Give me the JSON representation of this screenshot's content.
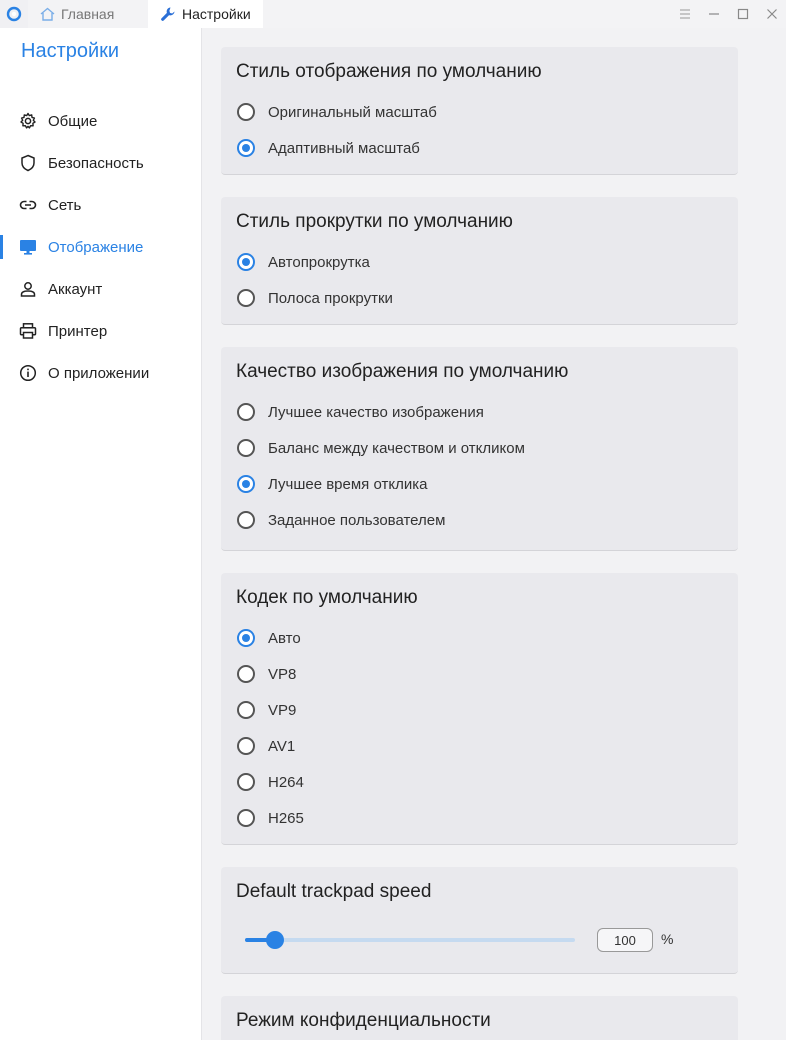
{
  "titlebar": {
    "tabs": [
      {
        "label": "Главная",
        "icon": "home-icon",
        "active": false
      },
      {
        "label": "Настройки",
        "icon": "wrench-icon",
        "active": true
      }
    ],
    "controls": [
      "menu-icon",
      "minimize-icon",
      "maximize-icon",
      "close-icon"
    ]
  },
  "sidebar": {
    "title": "Настройки",
    "items": [
      {
        "label": "Общие",
        "icon": "gear-icon",
        "active": false
      },
      {
        "label": "Безопасность",
        "icon": "shield-icon",
        "active": false
      },
      {
        "label": "Сеть",
        "icon": "link-icon",
        "active": false
      },
      {
        "label": "Отображение",
        "icon": "monitor-icon",
        "active": true
      },
      {
        "label": "Аккаунт",
        "icon": "person-icon",
        "active": false
      },
      {
        "label": "Принтер",
        "icon": "printer-icon",
        "active": false
      },
      {
        "label": "О приложении",
        "icon": "info-icon",
        "active": false
      }
    ]
  },
  "sections": {
    "view_style": {
      "title": "Стиль отображения по умолчанию",
      "options": [
        {
          "label": "Оригинальный масштаб",
          "selected": false
        },
        {
          "label": "Адаптивный масштаб",
          "selected": true
        }
      ]
    },
    "scroll_style": {
      "title": "Стиль прокрутки по умолчанию",
      "options": [
        {
          "label": "Автопрокрутка",
          "selected": true
        },
        {
          "label": "Полоса прокрутки",
          "selected": false
        }
      ]
    },
    "image_quality": {
      "title": "Качество изображения по умолчанию",
      "options": [
        {
          "label": "Лучшее качество изображения",
          "selected": false
        },
        {
          "label": "Баланс между качеством и откликом",
          "selected": false
        },
        {
          "label": "Лучшее время отклика",
          "selected": true
        },
        {
          "label": "Заданное пользователем",
          "selected": false
        }
      ]
    },
    "codec": {
      "title": "Кодек по умолчанию",
      "options": [
        {
          "label": "Авто",
          "selected": true
        },
        {
          "label": "VP8",
          "selected": false
        },
        {
          "label": "VP9",
          "selected": false
        },
        {
          "label": "AV1",
          "selected": false
        },
        {
          "label": "H264",
          "selected": false
        },
        {
          "label": "H265",
          "selected": false
        }
      ]
    },
    "trackpad": {
      "title": "Default trackpad speed",
      "value": "100",
      "unit": "%",
      "slider_fraction": 0.09
    },
    "privacy": {
      "title": "Режим конфиденциальности"
    }
  },
  "colors": {
    "accent": "#2a82e4"
  }
}
